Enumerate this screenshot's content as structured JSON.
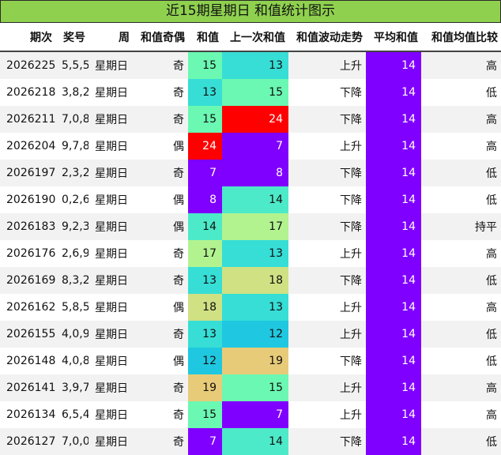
{
  "title": "近15期星期日 和值统计图示",
  "headers": [
    "期次",
    "奖号",
    "周",
    "和值奇偶",
    "和值",
    "上一次和值",
    "和值波动走势",
    "平均和值",
    "和值均值比较"
  ],
  "colors": {
    "title_bg": "#8fd14f",
    "avg_bg": "#8000ff",
    "row_alt_bg": "#f2f2f2",
    "scale": {
      "7": "#8000ff",
      "8": "#7f00ff",
      "12": "#1fc8e0",
      "13": "#36ded6",
      "14": "#4ceac8",
      "15": "#6bf8b2",
      "17": "#b2f390",
      "18": "#cfe183",
      "19": "#e8cb78",
      "24": "#ff0000"
    }
  },
  "chart_data": {
    "type": "table",
    "columns": [
      "期次",
      "奖号",
      "周",
      "和值奇偶",
      "和值",
      "上一次和值",
      "和值波动走势",
      "平均和值",
      "和值均值比较"
    ],
    "rows": [
      {
        "period": "2026225",
        "numbers": "5,5,5",
        "weekday": "星期日",
        "parity": "奇",
        "sum": 15,
        "prev_sum": 13,
        "trend": "上升",
        "avg": 14,
        "compare": "高"
      },
      {
        "period": "2026218",
        "numbers": "3,8,2",
        "weekday": "星期日",
        "parity": "奇",
        "sum": 13,
        "prev_sum": 15,
        "trend": "下降",
        "avg": 14,
        "compare": "低"
      },
      {
        "period": "2026211",
        "numbers": "7,0,8",
        "weekday": "星期日",
        "parity": "奇",
        "sum": 15,
        "prev_sum": 24,
        "trend": "下降",
        "avg": 14,
        "compare": "高"
      },
      {
        "period": "2026204",
        "numbers": "9,7,8",
        "weekday": "星期日",
        "parity": "偶",
        "sum": 24,
        "prev_sum": 7,
        "trend": "上升",
        "avg": 14,
        "compare": "高"
      },
      {
        "period": "2026197",
        "numbers": "2,3,2",
        "weekday": "星期日",
        "parity": "奇",
        "sum": 7,
        "prev_sum": 8,
        "trend": "下降",
        "avg": 14,
        "compare": "低"
      },
      {
        "period": "2026190",
        "numbers": "0,2,6",
        "weekday": "星期日",
        "parity": "偶",
        "sum": 8,
        "prev_sum": 14,
        "trend": "下降",
        "avg": 14,
        "compare": "低"
      },
      {
        "period": "2026183",
        "numbers": "9,2,3",
        "weekday": "星期日",
        "parity": "偶",
        "sum": 14,
        "prev_sum": 17,
        "trend": "下降",
        "avg": 14,
        "compare": "持平"
      },
      {
        "period": "2026176",
        "numbers": "2,6,9",
        "weekday": "星期日",
        "parity": "奇",
        "sum": 17,
        "prev_sum": 13,
        "trend": "上升",
        "avg": 14,
        "compare": "高"
      },
      {
        "period": "2026169",
        "numbers": "8,3,2",
        "weekday": "星期日",
        "parity": "奇",
        "sum": 13,
        "prev_sum": 18,
        "trend": "下降",
        "avg": 14,
        "compare": "低"
      },
      {
        "period": "2026162",
        "numbers": "5,8,5",
        "weekday": "星期日",
        "parity": "偶",
        "sum": 18,
        "prev_sum": 13,
        "trend": "上升",
        "avg": 14,
        "compare": "高"
      },
      {
        "period": "2026155",
        "numbers": "4,0,9",
        "weekday": "星期日",
        "parity": "奇",
        "sum": 13,
        "prev_sum": 12,
        "trend": "上升",
        "avg": 14,
        "compare": "低"
      },
      {
        "period": "2026148",
        "numbers": "4,0,8",
        "weekday": "星期日",
        "parity": "偶",
        "sum": 12,
        "prev_sum": 19,
        "trend": "下降",
        "avg": 14,
        "compare": "低"
      },
      {
        "period": "2026141",
        "numbers": "3,9,7",
        "weekday": "星期日",
        "parity": "奇",
        "sum": 19,
        "prev_sum": 15,
        "trend": "上升",
        "avg": 14,
        "compare": "高"
      },
      {
        "period": "2026134",
        "numbers": "6,5,4",
        "weekday": "星期日",
        "parity": "奇",
        "sum": 15,
        "prev_sum": 7,
        "trend": "上升",
        "avg": 14,
        "compare": "高"
      },
      {
        "period": "2026127",
        "numbers": "7,0,0",
        "weekday": "星期日",
        "parity": "奇",
        "sum": 7,
        "prev_sum": 14,
        "trend": "下降",
        "avg": 14,
        "compare": "低"
      }
    ]
  }
}
